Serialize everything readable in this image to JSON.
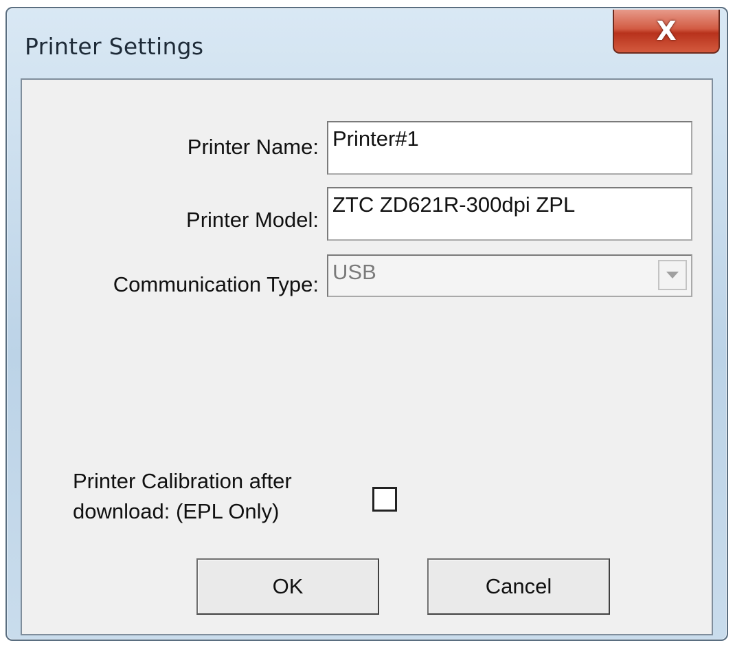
{
  "window": {
    "title": "Printer Settings",
    "close_glyph": "X"
  },
  "form": {
    "printer_name_label": "Printer Name:",
    "printer_name_value": "Printer#1",
    "printer_model_label": "Printer Model:",
    "printer_model_value": "ZTC ZD621R-300dpi ZPL",
    "comm_type_label": "Communication Type:",
    "comm_type_value": "USB",
    "calibration_label_line1": "Printer Calibration after",
    "calibration_label_line2": "download: (EPL Only)",
    "calibration_checked": false
  },
  "buttons": {
    "ok_label": "OK",
    "cancel_label": "Cancel"
  },
  "icons": {
    "close": "close-icon",
    "dropdown": "chevron-down-icon"
  }
}
